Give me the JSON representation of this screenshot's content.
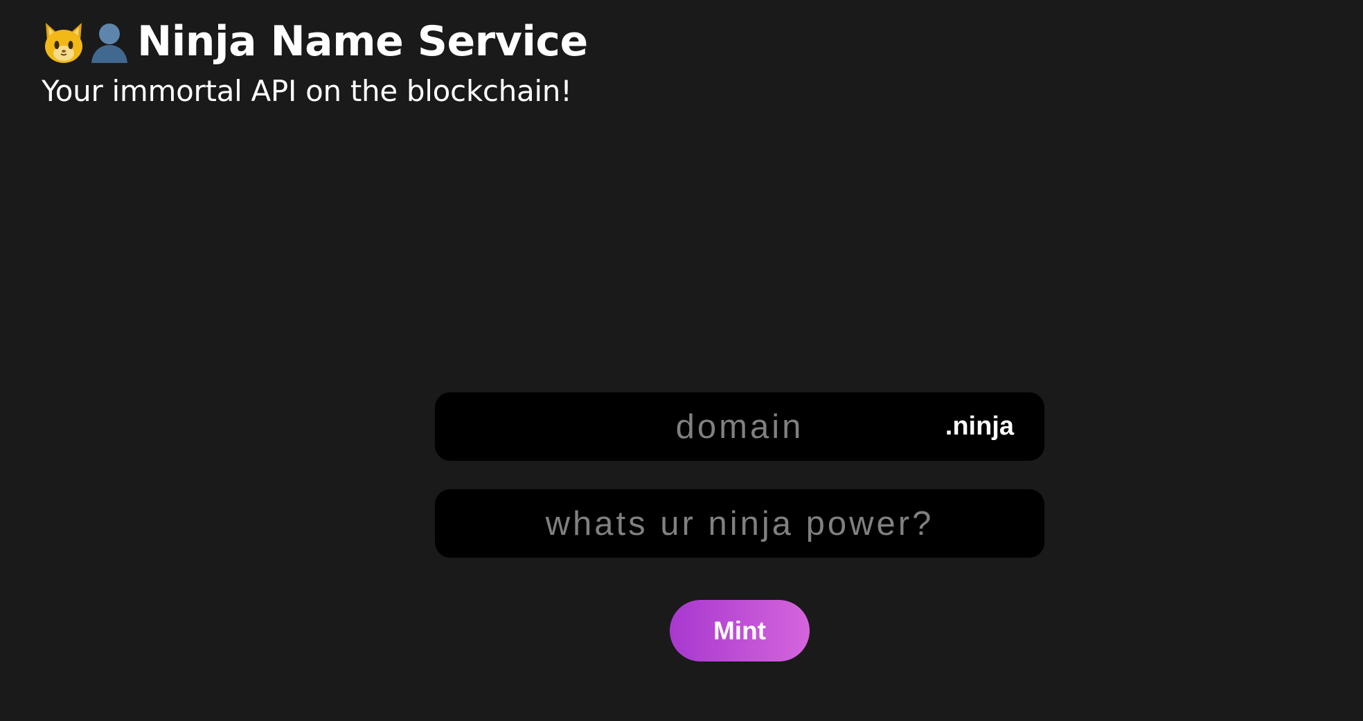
{
  "header": {
    "icons": [
      "cat-face-icon",
      "bust-in-silhouette-icon"
    ],
    "title": "Ninja Name Service",
    "subtitle": "Your immortal API on the blockchain!"
  },
  "form": {
    "domain": {
      "value": "",
      "placeholder": "domain",
      "suffix": ".ninja"
    },
    "power": {
      "value": "",
      "placeholder": "whats ur ninja power?"
    },
    "mint_label": "Mint"
  },
  "colors": {
    "background": "#1a1a1a",
    "field_background": "#000000",
    "placeholder": "#808080",
    "text": "#ffffff",
    "button_gradient_start": "#a838cf",
    "button_gradient_end": "#d565dc"
  }
}
